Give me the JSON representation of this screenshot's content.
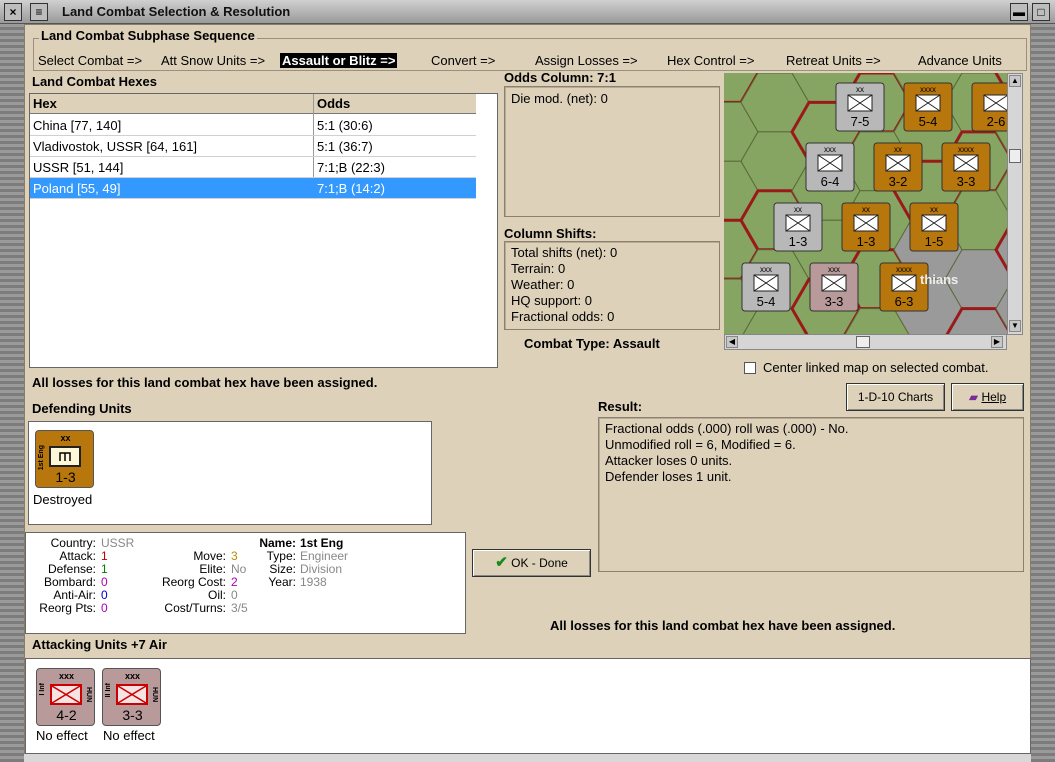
{
  "window": {
    "title": "Land Combat Selection & Resolution"
  },
  "subphase": {
    "title": "Land Combat Subphase Sequence",
    "items": [
      "Select Combat =>",
      "Att Snow Units =>",
      "Assault or Blitz =>",
      "Convert =>",
      "Assign Losses =>",
      "Hex Control =>",
      "Retreat Units =>",
      "Advance Units"
    ],
    "active_index": 2
  },
  "hexes": {
    "title": "Land Combat Hexes",
    "columns": [
      "Hex",
      "Odds"
    ],
    "rows": [
      {
        "hex": "China [77, 140]",
        "odds": "5:1 (30:6)"
      },
      {
        "hex": "Vladivostok, USSR [64, 161]",
        "odds": "5:1 (36:7)"
      },
      {
        "hex": "USSR [51, 144]",
        "odds": "7:1;B (22:3)"
      },
      {
        "hex": "Poland [55, 49]",
        "odds": "7:1;B (14:2)"
      }
    ],
    "selected_index": 3
  },
  "odds": {
    "title": "Odds Column: 7:1",
    "die_mod": "Die mod. (net): 0"
  },
  "shifts": {
    "title": "Column Shifts:",
    "lines": [
      "Total shifts (net): 0",
      "Terrain: 0",
      "Weather: 0",
      "HQ support: 0",
      "Fractional odds: 0"
    ]
  },
  "combat_type": "Combat Type:  Assault",
  "center_map_label": "Center linked map on selected combat.",
  "losses_msg": "All losses for this land combat hex have been assigned.",
  "defending": {
    "title": "Defending Units",
    "unit": {
      "size": "xx",
      "side": "1st Eng",
      "strength": "1-3",
      "status": "Destroyed"
    }
  },
  "unit_info": {
    "country_lbl": "Country:",
    "country": "USSR",
    "attack_lbl": "Attack:",
    "attack": "1",
    "defense_lbl": "Defense:",
    "defense": "1",
    "bombard_lbl": "Bombard:",
    "bombard": "0",
    "antiair_lbl": "Anti-Air:",
    "antiair": "0",
    "reorgpts_lbl": "Reorg Pts:",
    "reorgpts": "0",
    "move_lbl": "Move:",
    "move": "3",
    "elite_lbl": "Elite:",
    "elite": "No",
    "reorgcost_lbl": "Reorg Cost:",
    "reorgcost": "2",
    "oil_lbl": "Oil:",
    "oil": "0",
    "costturns_lbl": "Cost/Turns:",
    "costturns": "3/5",
    "name_lbl": "Name:",
    "name": "1st Eng",
    "type_lbl": "Type:",
    "type": "Engineer",
    "size_lbl": "Size:",
    "size": "Division",
    "year_lbl": "Year:",
    "year": "1938"
  },
  "buttons": {
    "charts": "1-D-10 Charts",
    "help": "Help",
    "ok": "OK - Done"
  },
  "result": {
    "title": "Result:",
    "lines": [
      "Fractional odds (.000) roll was (.000)  - No.",
      "Unmodified roll = 6, Modified = 6.",
      "Attacker loses 0 units.",
      "Defender loses 1 unit."
    ]
  },
  "attacking": {
    "title": "Attacking Units +7 Air",
    "units": [
      {
        "size": "xxx",
        "side_l": "I Inf",
        "side_r": "HUN",
        "strength": "4-2",
        "status": "No effect"
      },
      {
        "size": "xxx",
        "side_l": "II Inf",
        "side_r": "HUN",
        "strength": "3-3",
        "status": "No effect"
      }
    ]
  },
  "map": {
    "counters": [
      {
        "label": "5-4",
        "size": "xxxx",
        "color": "#b8770c"
      },
      {
        "label": "7-5",
        "size": "xx",
        "color": "#b8b8b8"
      },
      {
        "label": "2-6",
        "size": "",
        "color": "#b8770c"
      },
      {
        "label": "6-4",
        "size": "xxx",
        "color": "#b8b8b8"
      },
      {
        "label": "3-2",
        "size": "xx",
        "color": "#b8770c"
      },
      {
        "label": "3-3",
        "size": "xxxx",
        "color": "#b8770c"
      },
      {
        "label": "1-3",
        "size": "xx",
        "color": "#b8b8b8"
      },
      {
        "label": "1-3",
        "size": "xx",
        "color": "#b8770c"
      },
      {
        "label": "1-5",
        "size": "xx",
        "color": "#b8770c"
      },
      {
        "label": "5-4",
        "size": "xxx",
        "color": "#b8b8b8"
      },
      {
        "label": "3-3",
        "size": "xxx",
        "color": "#b89a9a"
      },
      {
        "label": "6-3",
        "size": "xxxx",
        "color": "#b8770c"
      }
    ],
    "place_label": "thians"
  }
}
